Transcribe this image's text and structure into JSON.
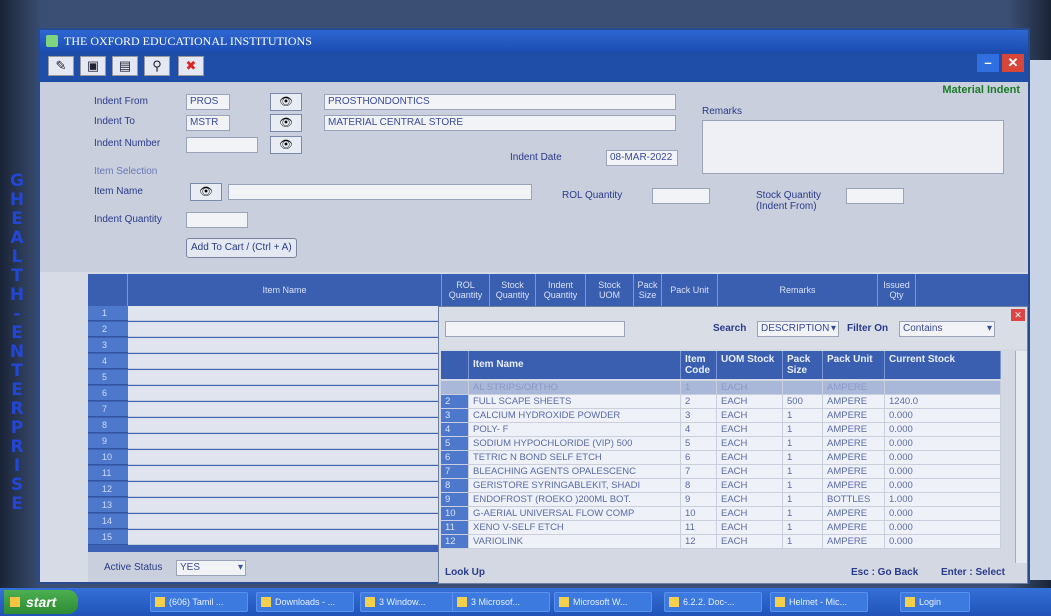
{
  "window": {
    "title": "THE OXFORD EDUCATIONAL INSTITUTIONS",
    "form_title": "Material Indent"
  },
  "side_text": [
    "G",
    "H",
    "E",
    "A",
    "L",
    "T",
    "H",
    "-",
    "E",
    "N",
    "T",
    "E",
    "R",
    "P",
    "R",
    "I",
    "S",
    "E"
  ],
  "toolbar": {
    "icons": [
      "edit-icon",
      "save-icon",
      "print-icon",
      "search-icon",
      "close-icon"
    ],
    "glyphs": [
      "✎",
      "▣",
      "▤",
      "⚲",
      "✖"
    ]
  },
  "controls": {
    "minimize": "–",
    "close": "✕"
  },
  "form": {
    "indent_from_label": "Indent From",
    "indent_from_code": "PROS",
    "indent_from_name": "PROSTHONDONTICS",
    "indent_to_label": "Indent To",
    "indent_to_code": "MSTR",
    "indent_to_name": "MATERIAL CENTRAL STORE",
    "indent_number_label": "Indent Number",
    "indent_number_value": "",
    "indent_date_label": "Indent Date",
    "indent_date_value": "08-MAR-2022",
    "remarks_label": "Remarks",
    "item_selection_label": "Item Selection",
    "item_name_label": "Item Name",
    "rol_quantity_label": "ROL Quantity",
    "stock_quantity_label": "Stock Quantity (Indent From)",
    "indent_quantity_label": "Indent Quantity",
    "add_to_cart_label": "Add To Cart / (Ctrl + A)",
    "binoculars": "👁"
  },
  "grid": {
    "headers": [
      "Item Name",
      "ROL Quantity",
      "Stock Quantity",
      "Indent Quantity",
      "Stock UOM",
      "Pack Size",
      "Pack Unit",
      "Remarks",
      "Issued Qty"
    ],
    "row_numbers": [
      "1",
      "2",
      "3",
      "4",
      "5",
      "6",
      "7",
      "8",
      "9",
      "10",
      "11",
      "12",
      "13",
      "14",
      "15"
    ]
  },
  "active_status": {
    "label": "Active Status",
    "value": "YES"
  },
  "lookup": {
    "search_label": "Search",
    "search_by": "DESCRIPTION",
    "filter_label": "Filter On",
    "filter_value": "Contains",
    "headers": [
      "Item Name",
      "Item Code",
      "UOM Stock",
      "Pack Size",
      "Pack Unit",
      "Current Stock"
    ],
    "rows": [
      [
        "",
        "AL STRIPS/ORTHO",
        "1",
        "EACH",
        "",
        "AMPERE",
        ""
      ],
      [
        "2",
        "FULL SCAPE SHEETS",
        "2",
        "EACH",
        "500",
        "AMPERE",
        "1240.0"
      ],
      [
        "3",
        "CALCIUM HYDROXIDE POWDER",
        "3",
        "EACH",
        "1",
        "AMPERE",
        "0.000"
      ],
      [
        "4",
        "POLY- F",
        "4",
        "EACH",
        "1",
        "AMPERE",
        "0.000"
      ],
      [
        "5",
        "SODIUM HYPOCHLORIDE (VIP) 500",
        "5",
        "EACH",
        "1",
        "AMPERE",
        "0.000"
      ],
      [
        "6",
        "TETRIC N BOND SELF ETCH",
        "6",
        "EACH",
        "1",
        "AMPERE",
        "0.000"
      ],
      [
        "7",
        "BLEACHING AGENTS OPALESCENC",
        "7",
        "EACH",
        "1",
        "AMPERE",
        "0.000"
      ],
      [
        "8",
        "GERISTORE SYRINGABLEKIT, SHADI",
        "8",
        "EACH",
        "1",
        "AMPERE",
        "0.000"
      ],
      [
        "9",
        "ENDOFROST (ROEKO )200ML BOT.",
        "9",
        "EACH",
        "1",
        "BOTTLES",
        "1.000"
      ],
      [
        "10",
        "G-AERIAL UNIVERSAL FLOW COMP",
        "10",
        "EACH",
        "1",
        "AMPERE",
        "0.000"
      ],
      [
        "11",
        "XENO V-SELF ETCH",
        "11",
        "EACH",
        "1",
        "AMPERE",
        "0.000"
      ],
      [
        "12",
        "VARIOLINK",
        "12",
        "EACH",
        "1",
        "AMPERE",
        "0.000"
      ]
    ],
    "footer_left": "Look Up",
    "footer_esc": "Esc : Go Back",
    "footer_enter": "Enter : Select"
  },
  "taskbar": {
    "start_label": "start",
    "tasks": [
      "(606) Tamil ...",
      "Downloads - ...",
      "3 Window...",
      "3 Microsof...",
      "Microsoft W...",
      "6.2.2. Doc-...",
      "Helmet - Mic...",
      "Login"
    ]
  }
}
